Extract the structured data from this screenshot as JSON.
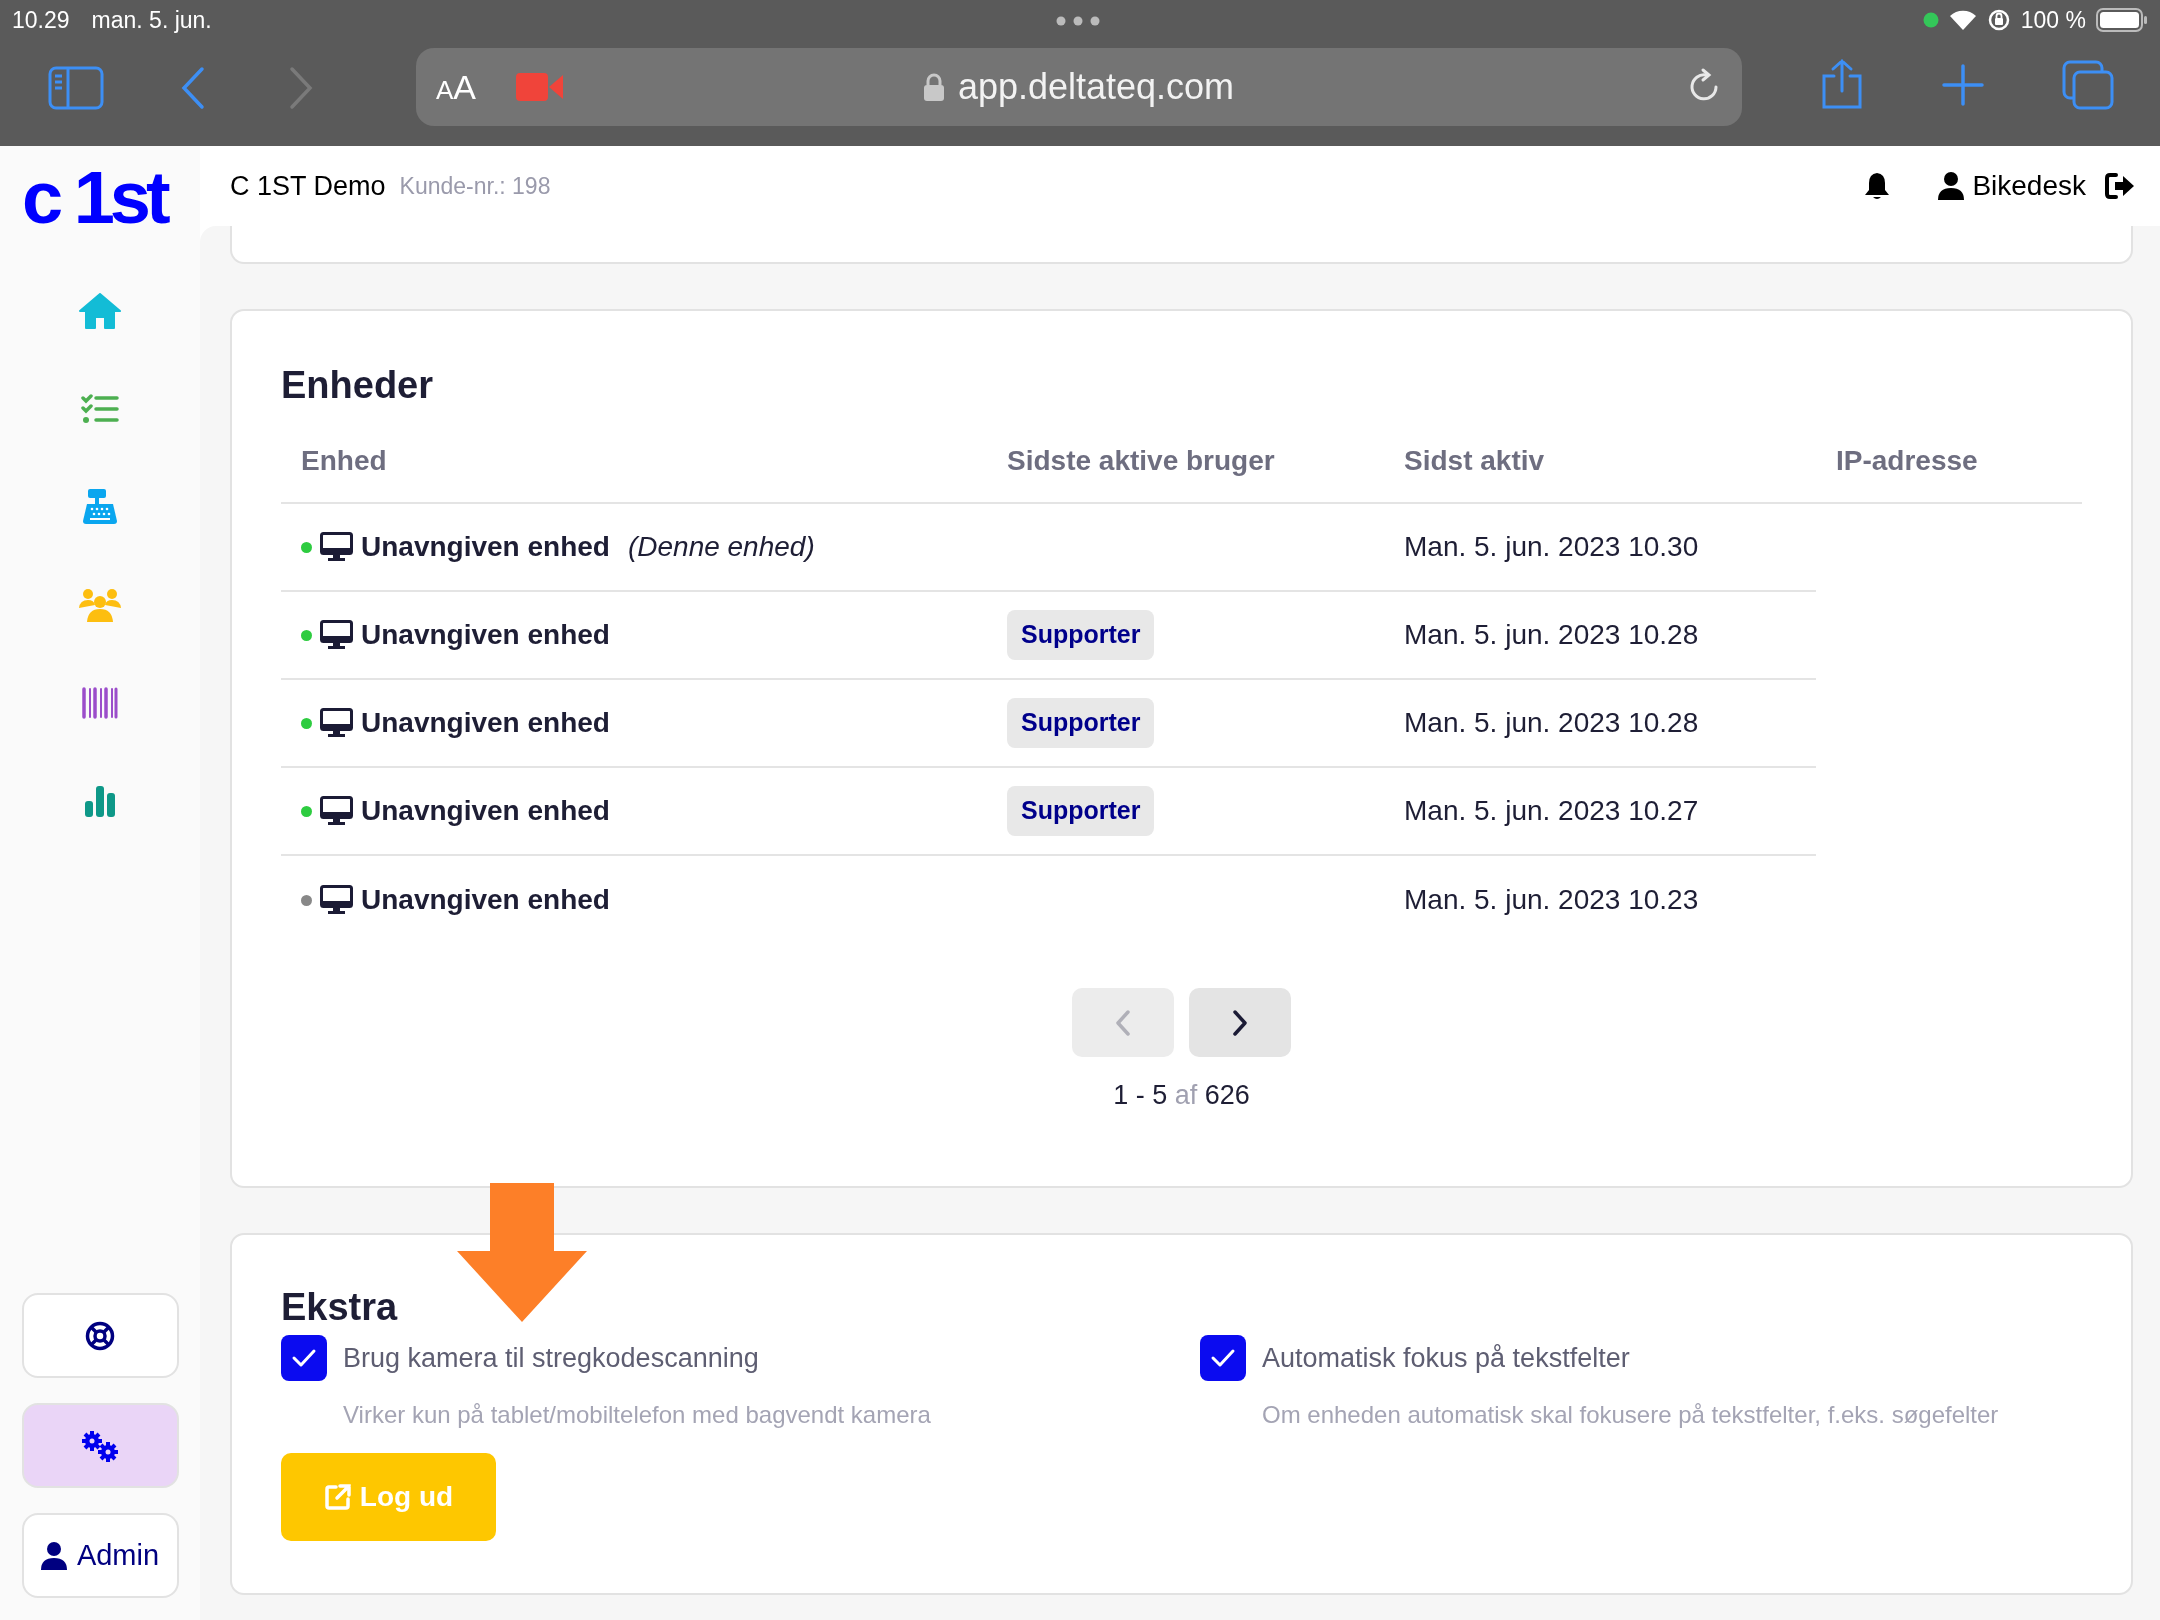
{
  "browser": {
    "time": "10.29",
    "date": "man. 5. jun.",
    "battery": "100 %",
    "text_size": "AA",
    "url": "app.deltateq.com"
  },
  "sidebar": {
    "logo": "c 1st",
    "nav": [
      {
        "kind": "home"
      },
      {
        "kind": "tasks"
      },
      {
        "kind": "register"
      },
      {
        "kind": "customers"
      },
      {
        "kind": "barcode"
      },
      {
        "kind": "stats"
      }
    ],
    "bottom": [
      {
        "kind": "support",
        "selected": false
      },
      {
        "kind": "settings",
        "selected": true
      },
      {
        "kind": "user",
        "label": "Admin",
        "selected": false
      }
    ]
  },
  "header": {
    "company": "C 1ST Demo",
    "customer_no": "Kunde-nr.: 198",
    "user": "Bikedesk"
  },
  "devices": {
    "title": "Enheder",
    "columns": [
      "Enhed",
      "Sidste aktive bruger",
      "Sidst aktiv",
      "IP-adresse"
    ],
    "rows": [
      {
        "online": true,
        "name": "Unavngiven enhed",
        "note": "(Denne enhed)",
        "last_active": "Man. 5. jun. 2023 10.30"
      },
      {
        "online": true,
        "name": "Unavngiven enhed",
        "last_user": "Supporter",
        "last_active": "Man. 5. jun. 2023 10.28"
      },
      {
        "online": true,
        "name": "Unavngiven enhed",
        "last_user": "Supporter",
        "last_active": "Man. 5. jun. 2023 10.28"
      },
      {
        "online": true,
        "name": "Unavngiven enhed",
        "last_user": "Supporter",
        "last_active": "Man. 5. jun. 2023 10.27"
      },
      {
        "online": false,
        "name": "Unavngiven enhed",
        "last_active": "Man. 5. jun. 2023 10.23"
      }
    ],
    "pagination": {
      "prev_disabled": true,
      "next_disabled": false,
      "range": "1 - 5",
      "of": "af",
      "total": "626"
    }
  },
  "extra": {
    "title": "Ekstra",
    "options": [
      {
        "label": "Brug kamera til stregkodescanning",
        "hint": "Virker kun på tablet/mobiltelefon med bagvendt kamera",
        "checked": true
      },
      {
        "label": "Automatisk fokus på tekstfelter",
        "hint": "Om enheden automatisk skal fokusere på tekstfelter, f.eks. søgefelter",
        "checked": true
      }
    ],
    "logout": "Log ud"
  }
}
